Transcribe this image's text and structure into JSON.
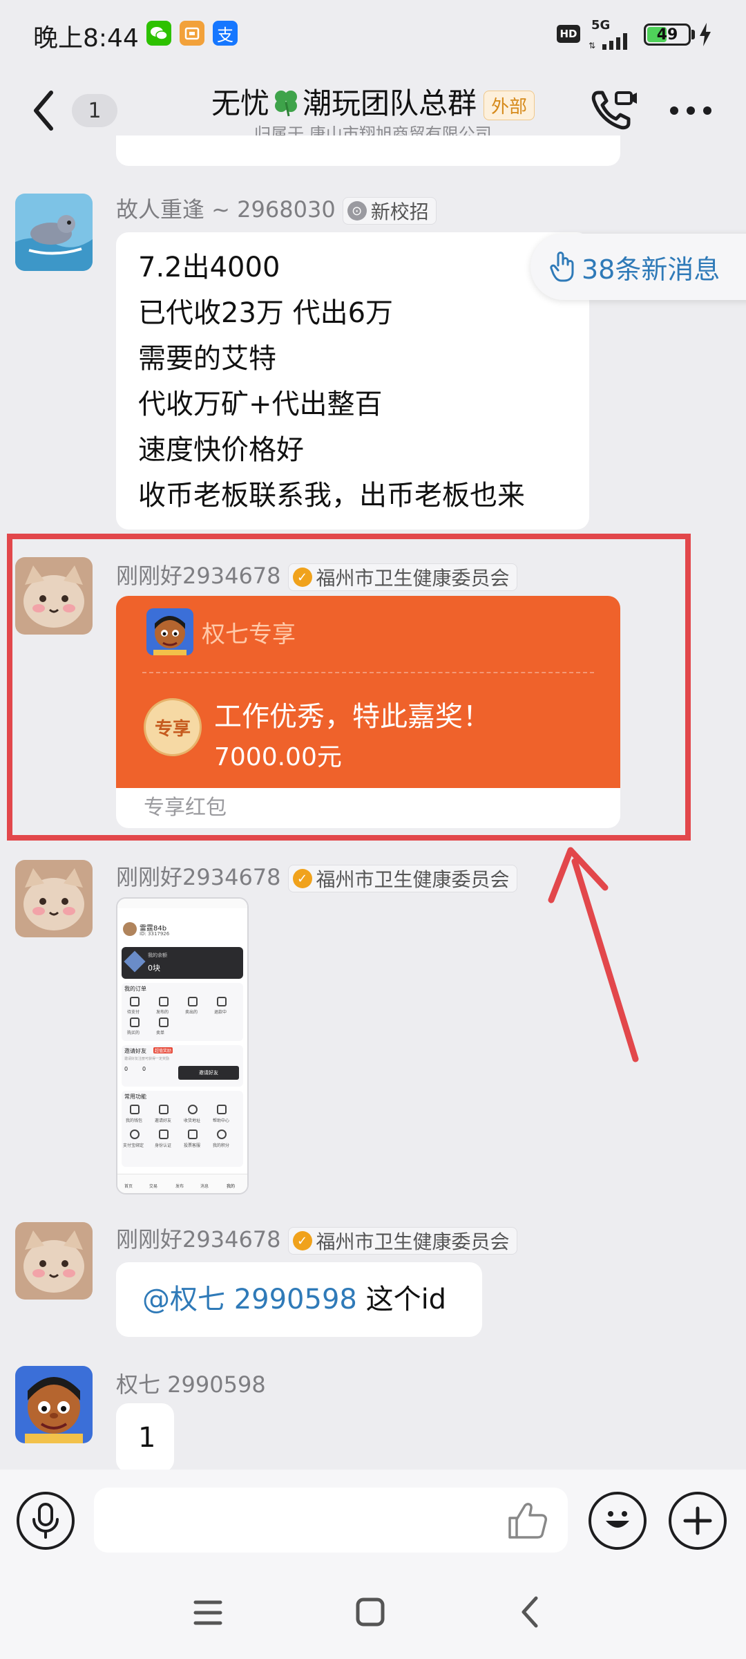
{
  "status_bar": {
    "time": "晚上8:44",
    "app_icons": [
      {
        "name": "wechat-icon",
        "glyph": "💬",
        "color": "#2dc100"
      },
      {
        "name": "box-app-icon",
        "glyph": "▣",
        "color": "#f2a13a"
      },
      {
        "name": "alipay-icon",
        "glyph": "支",
        "color": "#1677ff"
      }
    ],
    "hd": "HD",
    "network": "5G",
    "battery_level": 49,
    "battery_text": "49"
  },
  "header": {
    "back_count": "1",
    "title_part1": "无忧",
    "title_part2": "潮玩团队总群",
    "external_tag": "外部",
    "subtitle": "归属于 唐山市翔旭商贸有限公司"
  },
  "new_messages_pill": "38条新消息",
  "messages": [
    {
      "sender": "故人重逢 ~ 2968030",
      "badge": "新校招",
      "lines": [
        "7.2出4000",
        "已代收23万 代出6万",
        "需要的艾特",
        "代收万矿+代出整百",
        "速度快价格好",
        "收币老板联系我，出币老板也来"
      ]
    },
    {
      "sender": "刚刚好2934678",
      "badge": "福州市卫生健康委员会",
      "packet": {
        "user": "权七专享",
        "seal": "专享",
        "message": "工作优秀，特此嘉奖！",
        "amount": "7000.00元",
        "footer": "专享红包"
      }
    },
    {
      "sender": "刚刚好2934678",
      "badge": "福州市卫生健康委员会",
      "thumbnail": {
        "name": "雷霆84b",
        "id": "ID: 3317926",
        "wallet_label": "我的余额",
        "wallet_value": "0块",
        "orders_label": "我的订单",
        "order_items": [
          "待支付",
          "发布的",
          "卖出的",
          "退款中",
          "购买的",
          "卖单"
        ],
        "invite_label": "邀请好友",
        "invite_tag": "超值奖励",
        "invite_desc": "邀请好友注册可获得一定奖励",
        "invite_button": "邀请好友",
        "tools_label": "常用功能",
        "tool_items": [
          "我的钱包",
          "邀请好友",
          "收货地址",
          "帮助中心",
          "支付宝绑定",
          "身份认证",
          "投票客服",
          "我的积分"
        ],
        "tab_items": [
          "首页",
          "交易",
          "发布",
          "消息",
          "我的"
        ]
      }
    },
    {
      "sender": "刚刚好2934678",
      "badge": "福州市卫生健康委员会",
      "mention": "@权七 2990598",
      "text": " 这个id"
    },
    {
      "sender": "权七 2990598",
      "text": "1"
    }
  ],
  "colors": {
    "packet_orange": "#ef622b",
    "highlight_red": "#e2474b",
    "mention_blue": "#2f7ab8",
    "badge_gold": "#f0a21c"
  }
}
